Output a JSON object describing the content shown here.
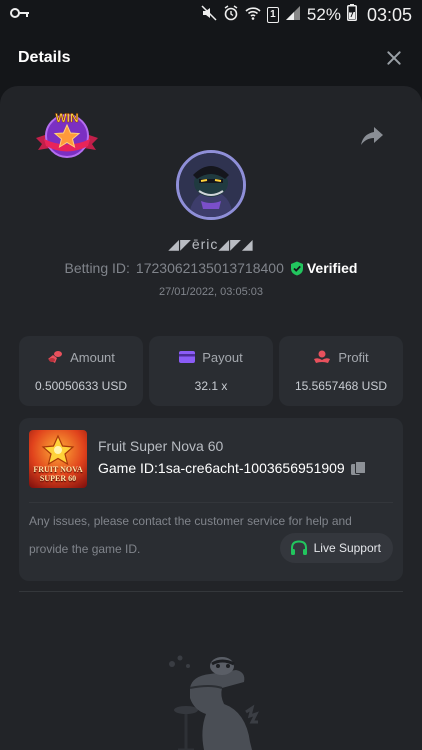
{
  "status_bar": {
    "battery_percent": "52%",
    "time": "03:05",
    "sim_label": "1"
  },
  "header": {
    "title": "Details"
  },
  "badge": {
    "text": "WIN"
  },
  "user": {
    "name": "◢◤ēric◢◤◢",
    "betting_id_label": "Betting ID:",
    "betting_id": "1723062135013718400",
    "verified_label": "Verified",
    "date": "27/01/2022, 03:05:03"
  },
  "stats": [
    {
      "label": "Amount",
      "value": "0.50050633 USD",
      "icon": "coins-icon",
      "color": "#e8515d"
    },
    {
      "label": "Payout",
      "value": "32.1 x",
      "icon": "card-icon",
      "color": "#8b5cf6"
    },
    {
      "label": "Profit",
      "value": "15.5657468 USD",
      "icon": "profit-icon",
      "color": "#e8515d"
    }
  ],
  "game": {
    "name": "Fruit Super Nova 60",
    "id_label": "Game ID:",
    "id": "1sa-cre6acht-1003656951909",
    "thumb_text_line1": "FRUIT NOVA",
    "thumb_text_line2": "SUPER 60",
    "notice_line1": "Any issues, please contact the customer service for help and",
    "notice_line2": "provide the game ID.",
    "support_label": "Live Support"
  },
  "colors": {
    "background": "#141619",
    "sheet": "#222428",
    "card": "#2a2d32",
    "verified_green": "#22c55e",
    "support_green": "#22c55e"
  }
}
